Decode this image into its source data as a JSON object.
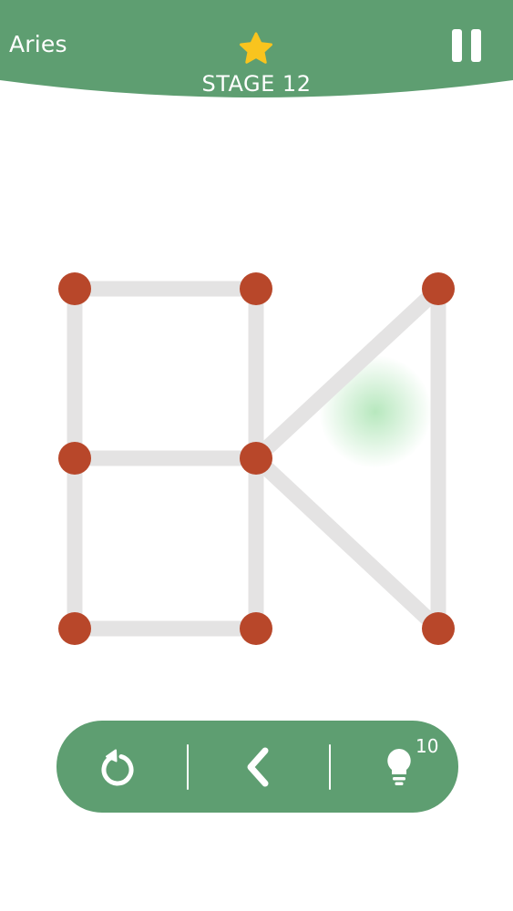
{
  "header": {
    "title": "Aries",
    "stage": "STAGE 12"
  },
  "toolbar": {
    "hint_count": "10"
  },
  "colors": {
    "header_green": "#5e9e71",
    "node": "#b8472a",
    "edge": "#e4e3e3",
    "star": "#f9c41e",
    "glow": "#9fe0a8"
  },
  "icons": {
    "star": "star-icon",
    "pause": "pause-icon",
    "restart": "restart-icon",
    "back": "chevron-left-icon",
    "hint": "lightbulb-icon"
  },
  "puzzle": {
    "nodes": [
      {
        "id": "A",
        "row": 0,
        "col": 0
      },
      {
        "id": "B",
        "row": 0,
        "col": 1
      },
      {
        "id": "C",
        "row": 0,
        "col": 2
      },
      {
        "id": "D",
        "row": 1,
        "col": 0
      },
      {
        "id": "E",
        "row": 1,
        "col": 1
      },
      {
        "id": "F",
        "row": 2,
        "col": 0
      },
      {
        "id": "G",
        "row": 2,
        "col": 1
      },
      {
        "id": "H",
        "row": 2,
        "col": 2
      }
    ],
    "edges": [
      [
        "A",
        "B"
      ],
      [
        "A",
        "D"
      ],
      [
        "B",
        "E"
      ],
      [
        "D",
        "E"
      ],
      [
        "D",
        "F"
      ],
      [
        "E",
        "G"
      ],
      [
        "F",
        "G"
      ],
      [
        "E",
        "C"
      ],
      [
        "E",
        "H"
      ],
      [
        "C",
        "H"
      ]
    ]
  }
}
